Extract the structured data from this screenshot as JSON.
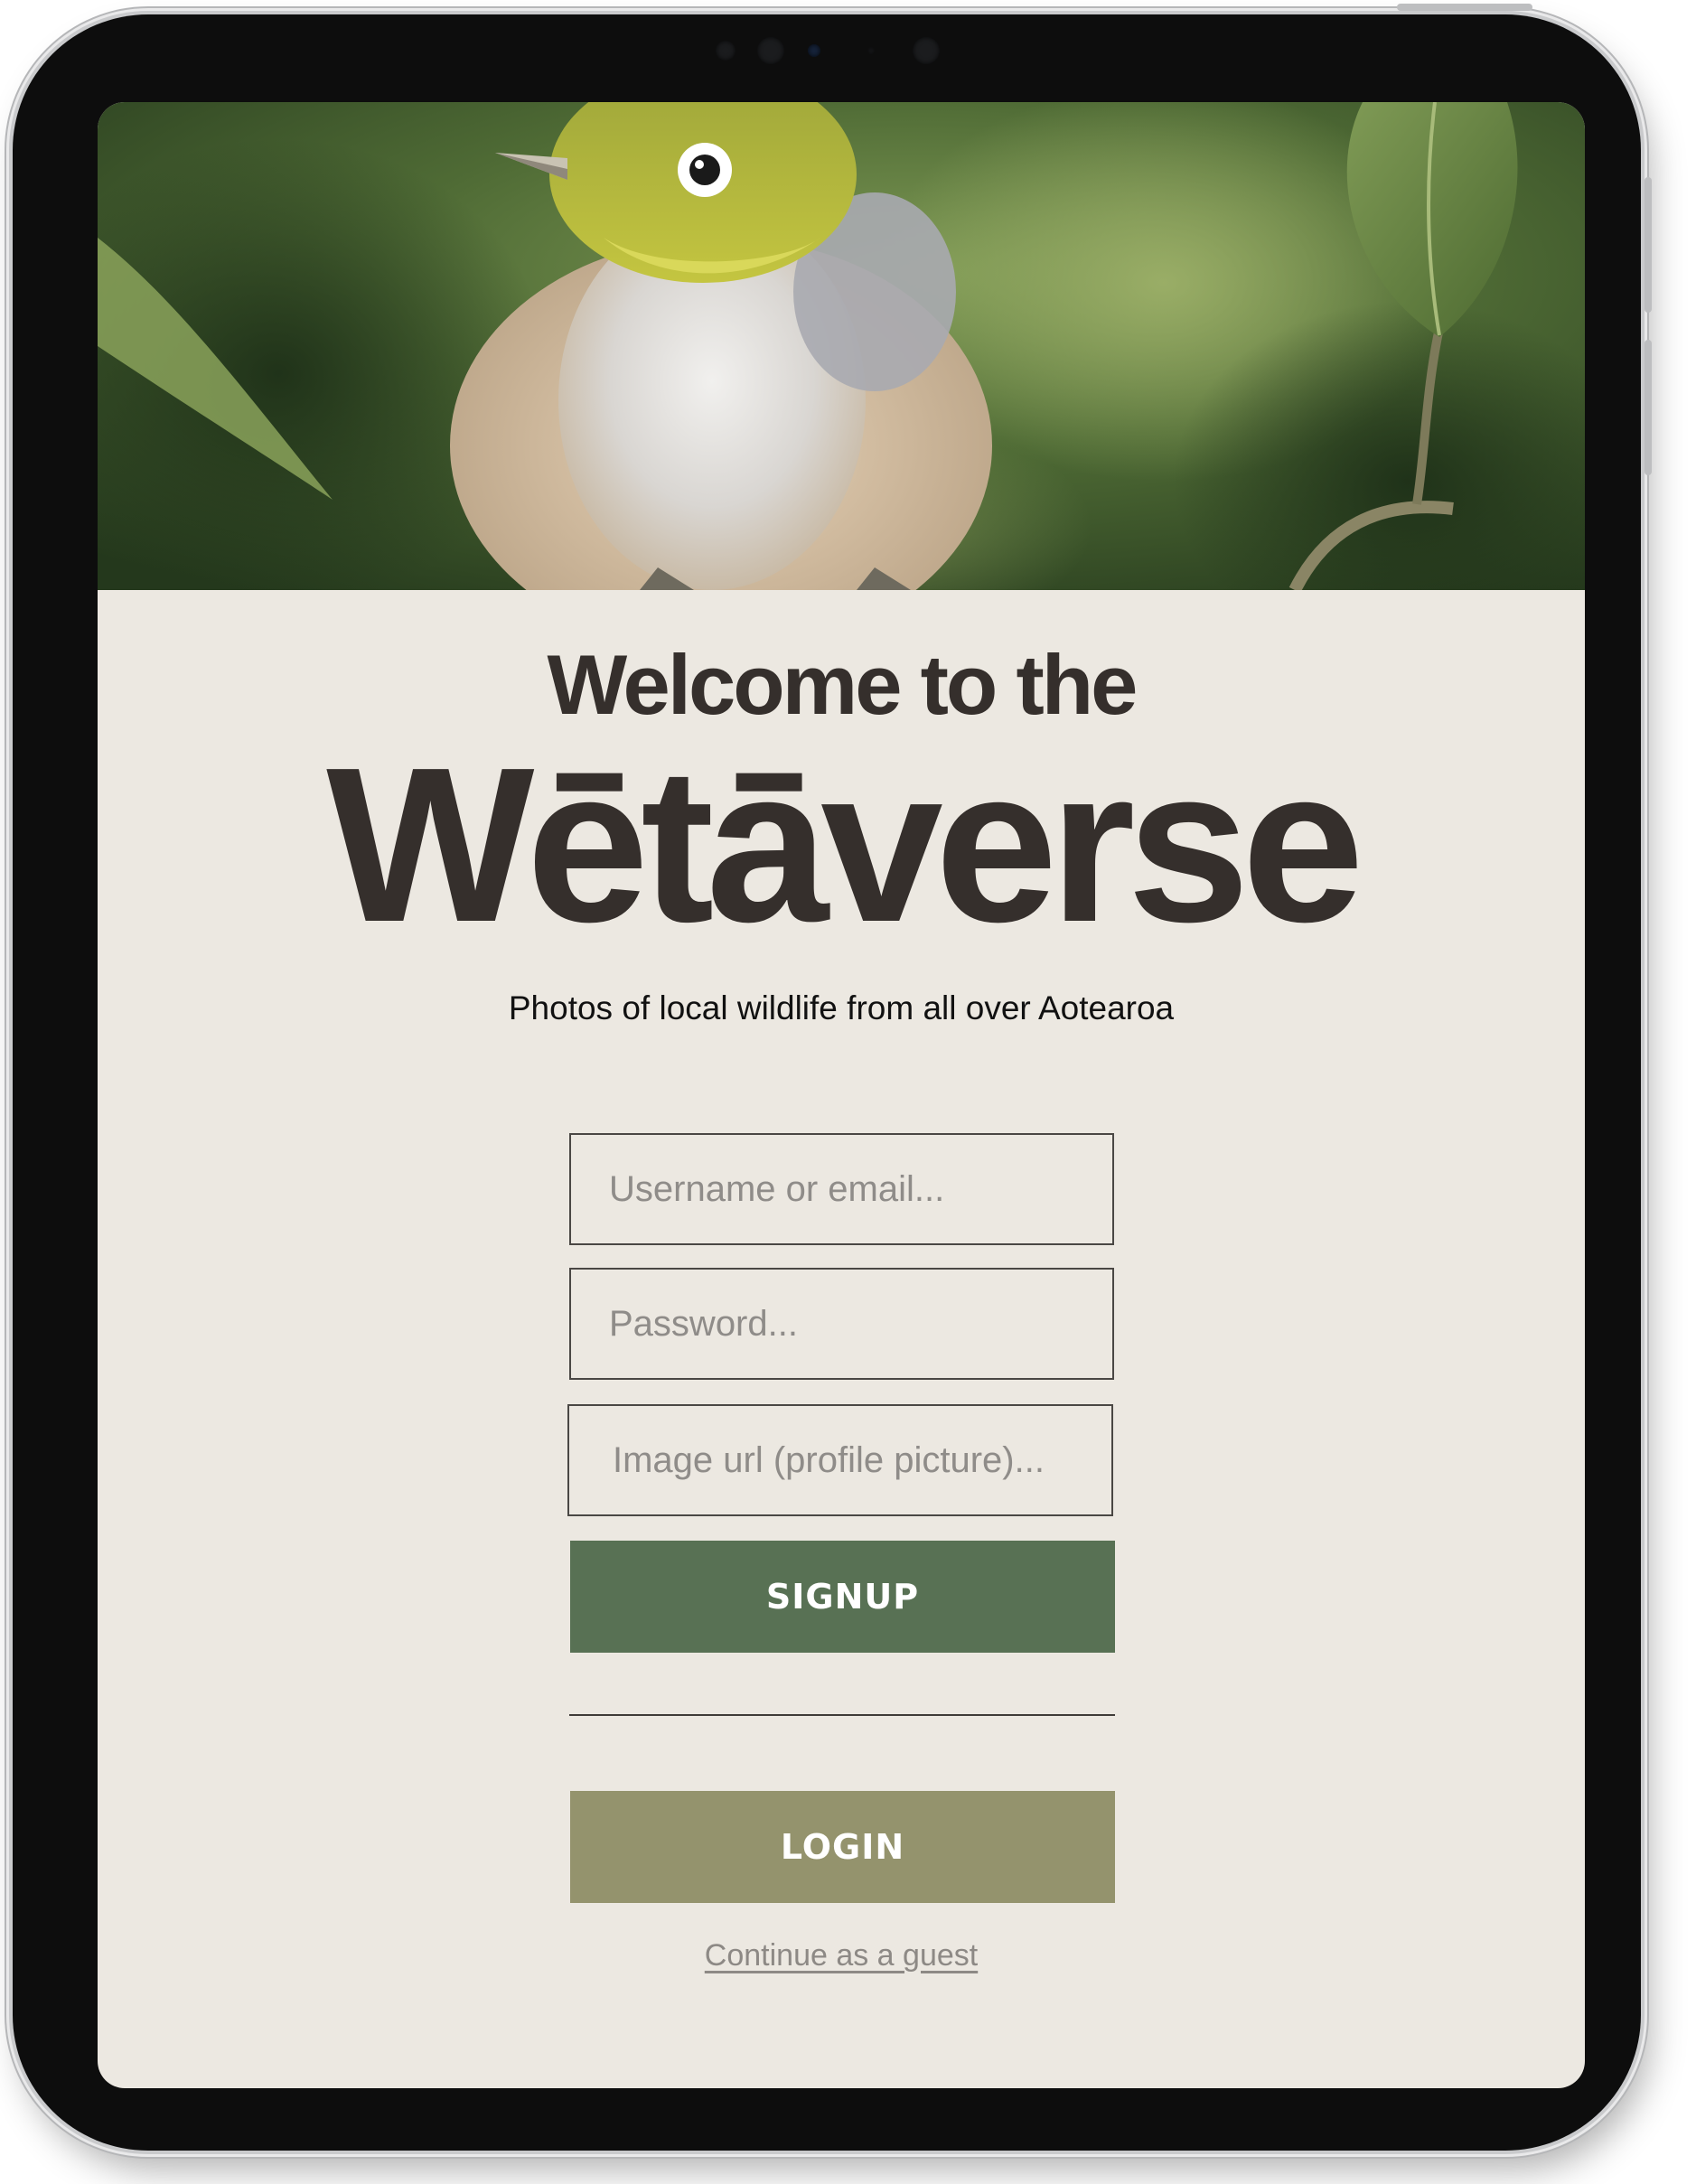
{
  "heading": {
    "welcome": "Welcome to the",
    "brand": "Wētāverse",
    "tagline": "Photos of local wildlife from all over Aotearoa"
  },
  "form": {
    "username": {
      "value": "",
      "placeholder": "Username or email..."
    },
    "password": {
      "value": "",
      "placeholder": "Password..."
    },
    "image_url": {
      "value": "",
      "placeholder": "Image url (profile picture)..."
    },
    "signup_label": "SIGNUP",
    "login_label": "LOGIN",
    "guest_label": "Continue as a guest"
  },
  "colors": {
    "background": "#ece8e1",
    "text": "#352f2c",
    "signup": "#587154",
    "login": "#94936d"
  }
}
